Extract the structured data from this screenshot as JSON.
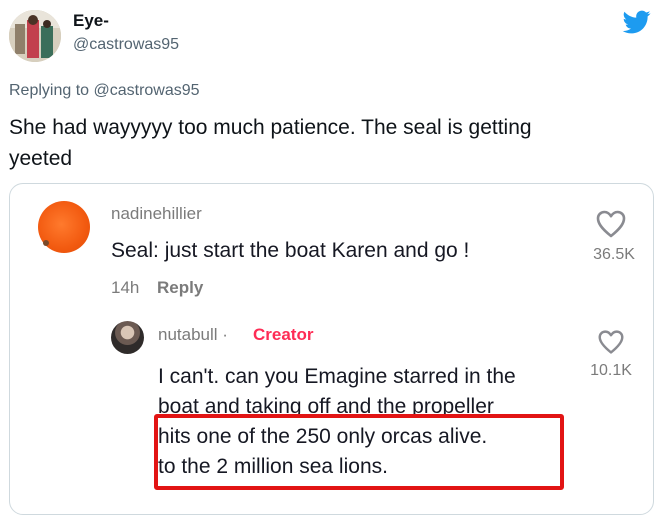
{
  "user": {
    "display_name": "Eye-",
    "handle": "@castrowas95"
  },
  "tweet": {
    "replying_to": "Replying to @castrowas95",
    "text_line1": "She had wayyyyy too much patience. The seal is getting",
    "text_line2": "yeeted"
  },
  "screenshot": {
    "comment1": {
      "username": "nadinehillier",
      "text": "Seal: just start the boat Karen and go !",
      "time": "14h",
      "reply_label": "Reply",
      "likes": "36.5K"
    },
    "comment2": {
      "username": "nutabull ·",
      "badge": "Creator",
      "lines": [
        "I can't. can you Emagine starred in the",
        "boat and taking off and the propeller",
        "hits one of the 250 only orcas alive.",
        "to the 2 million sea lions."
      ],
      "likes": "10.1K"
    }
  },
  "colors": {
    "twitter_blue": "#1d9bf0",
    "creator_red": "#fe2c55",
    "highlight_red": "#e21414"
  },
  "icons": [
    "twitter-logo-icon",
    "heart-icon"
  ]
}
